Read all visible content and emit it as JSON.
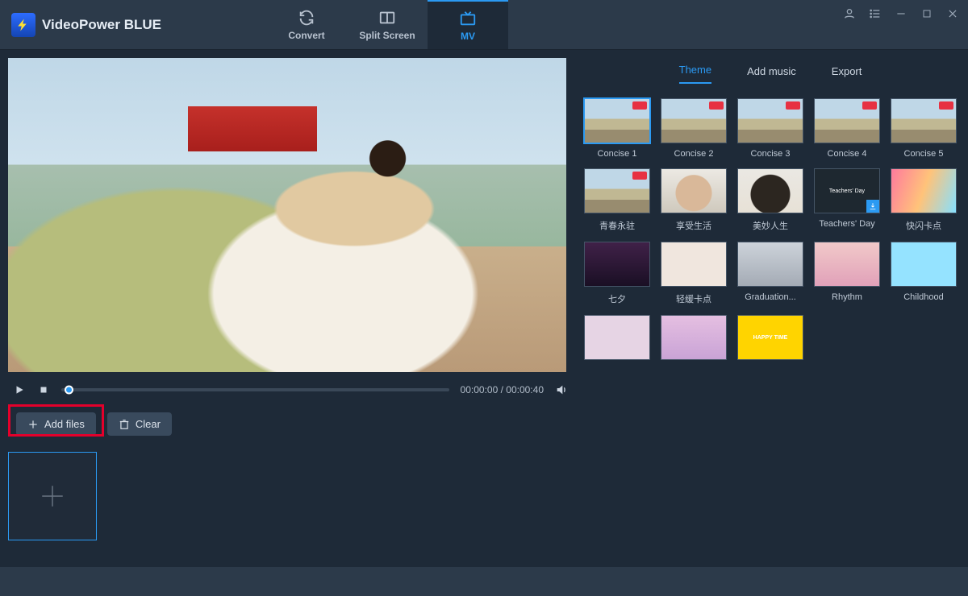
{
  "app": {
    "title": "VideoPower BLUE"
  },
  "topTabs": {
    "convert": "Convert",
    "split": "Split Screen",
    "mv": "MV"
  },
  "player": {
    "time_current": "00:00:00",
    "time_total": "00:00:40"
  },
  "actions": {
    "add_files": "Add files",
    "clear": "Clear"
  },
  "rightTabs": {
    "theme": "Theme",
    "add_music": "Add music",
    "export": "Export"
  },
  "themes": [
    {
      "label": "Concise 1",
      "cls": "tA",
      "active": true,
      "hot": true
    },
    {
      "label": "Concise 2",
      "cls": "tA",
      "active": false,
      "hot": true
    },
    {
      "label": "Concise 3",
      "cls": "tA",
      "active": false,
      "hot": true
    },
    {
      "label": "Concise 4",
      "cls": "tA",
      "active": false,
      "hot": true
    },
    {
      "label": "Concise 5",
      "cls": "tA",
      "active": false,
      "hot": true
    },
    {
      "label": "青春永驻",
      "cls": "tA",
      "active": false,
      "hot": true
    },
    {
      "label": "享受生活",
      "cls": "tB",
      "active": false,
      "hot": false
    },
    {
      "label": "美妙人生",
      "cls": "tC",
      "active": false,
      "hot": false
    },
    {
      "label": "Teachers' Day",
      "cls": "tE",
      "active": false,
      "hot": false,
      "dl": true
    },
    {
      "label": "快闪卡点",
      "cls": "tF",
      "active": false,
      "hot": false
    },
    {
      "label": "七夕",
      "cls": "tG",
      "active": false,
      "hot": false
    },
    {
      "label": "轻缓卡点",
      "cls": "tH",
      "active": false,
      "hot": false
    },
    {
      "label": "Graduation...",
      "cls": "tI",
      "active": false,
      "hot": false
    },
    {
      "label": "Rhythm",
      "cls": "tJ",
      "active": false,
      "hot": false
    },
    {
      "label": "Childhood",
      "cls": "tK",
      "active": false,
      "hot": false
    },
    {
      "label": "",
      "cls": "tL",
      "active": false,
      "hot": false
    },
    {
      "label": "",
      "cls": "tM",
      "active": false,
      "hot": false
    },
    {
      "label": "",
      "cls": "tN",
      "active": false,
      "hot": false
    }
  ]
}
